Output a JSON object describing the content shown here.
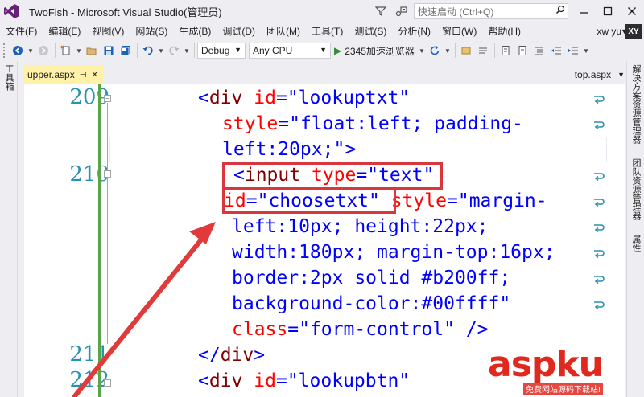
{
  "window": {
    "title": "TwoFish - Microsoft Visual Studio(管理员)",
    "quick_launch_placeholder": "快速启动 (Ctrl+Q)"
  },
  "menu": {
    "items": [
      "文件(F)",
      "编辑(E)",
      "视图(V)",
      "网站(S)",
      "生成(B)",
      "调试(D)",
      "团队(M)",
      "工具(T)",
      "测试(S)",
      "分析(N)",
      "窗口(W)",
      "帮助(H)"
    ],
    "user_name": "xw yu",
    "avatar_initials": "XY"
  },
  "toolbar": {
    "config": "Debug",
    "platform": "Any CPU",
    "run_target": "2345加速浏览器"
  },
  "left_strip": {
    "toolbox_label": "工具箱"
  },
  "right_strip": {
    "labels": [
      "解决方案资源管理器",
      "团队资源管理器",
      "属性"
    ]
  },
  "tabs": {
    "active": "upper.aspx",
    "right_tab": "top.aspx"
  },
  "editor": {
    "line_numbers": [
      "209",
      "210",
      "211",
      "212"
    ],
    "code_lines": [
      {
        "tag": "<",
        "name": "div",
        "sp": " ",
        "attr": "id",
        "eq": "=",
        "val": "\"lookuptxt\""
      },
      {
        "attr": "style",
        "eq": "=",
        "val": "\"float:left; padding-"
      },
      {
        "val": "left:20px;\"",
        "punc": ">"
      },
      {
        "tag": "<",
        "name": "input",
        "sp": " ",
        "attr": "type",
        "eq": "=",
        "val": "\"text\""
      },
      {
        "attr": "id",
        "eq": "=",
        "val": "\"choosetxt\"",
        "attr2": " style",
        "eq2": "=",
        "val2": "\"margin-"
      },
      {
        "val": "left:10px; height:22px;"
      },
      {
        "val": "width:180px; margin-top:16px;"
      },
      {
        "val": "border:2px solid #b200ff;"
      },
      {
        "val": "background-color:#00ffff\""
      },
      {
        "attr": "class",
        "eq": "=",
        "val": "\"form-control\"",
        "punc": " />"
      },
      {
        "tag": "</",
        "name": "div",
        "punc": ">"
      },
      {
        "tag": "<",
        "name": "div",
        "sp": " ",
        "attr": "id",
        "eq": "=",
        "val": "\"lookupbtn\""
      }
    ]
  },
  "watermark": {
    "brand": "aspku",
    "tagline": "免费网站源码下载站!"
  },
  "colors": {
    "highlight": "#d9363e",
    "tab_active": "#fff2a8",
    "change_bar": "#57a64a",
    "line_number": "#2b91af"
  }
}
